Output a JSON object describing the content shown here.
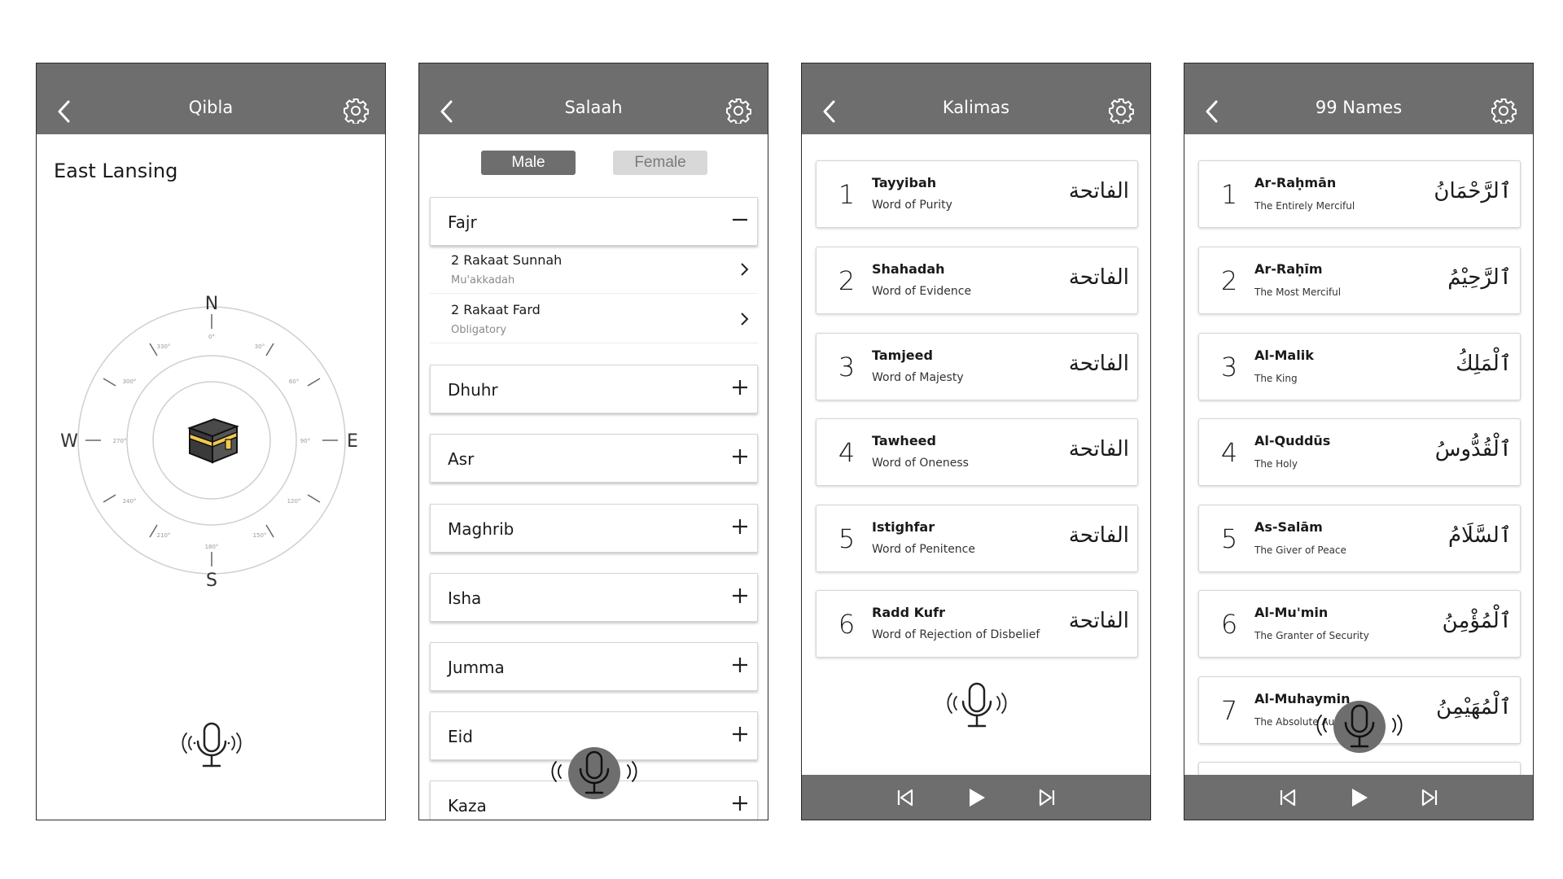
{
  "qibla": {
    "title": "Qibla",
    "city": "East Lansing",
    "compass": {
      "n": "N",
      "e": "E",
      "s": "S",
      "w": "W",
      "deg0": "0°",
      "deg30": "30°",
      "deg60": "60°",
      "deg90": "90°",
      "deg120": "120°",
      "deg150": "150°",
      "deg180": "180°",
      "deg210": "210°",
      "deg240": "240°",
      "deg270": "270°",
      "deg300": "300°",
      "deg330": "330°"
    }
  },
  "salaah": {
    "title": "Salaah",
    "male": "Male",
    "female": "Female",
    "fajr": "Fajr",
    "fajr_items": [
      {
        "title": "2 Rakaat Sunnah",
        "sub": "Mu'akkadah"
      },
      {
        "title": "2 Rakaat Fard",
        "sub": "Obligatory"
      }
    ],
    "prayers": [
      "Dhuhr",
      "Asr",
      "Maghrib",
      "Isha",
      "Jumma",
      "Eid",
      "Kaza"
    ]
  },
  "kalimas": {
    "title": "Kalimas",
    "items": [
      {
        "num": "1",
        "title": "Tayyibah",
        "sub": "Word of Purity",
        "arabic": "الفاتحة"
      },
      {
        "num": "2",
        "title": "Shahadah",
        "sub": "Word of Evidence",
        "arabic": "الفاتحة"
      },
      {
        "num": "3",
        "title": "Tamjeed",
        "sub": "Word of Majesty",
        "arabic": "الفاتحة"
      },
      {
        "num": "4",
        "title": "Tawheed",
        "sub": "Word of Oneness",
        "arabic": "الفاتحة"
      },
      {
        "num": "5",
        "title": "Istighfar",
        "sub": "Word of Penitence",
        "arabic": "الفاتحة"
      },
      {
        "num": "6",
        "title": "Radd Kufr",
        "sub": "Word of Rejection of Disbelief",
        "arabic": "الفاتحة"
      }
    ]
  },
  "names": {
    "title": "99 Names",
    "items": [
      {
        "num": "1",
        "title": "Ar-Raḥmān",
        "sub": "The Entirely Merciful",
        "arabic": "ٱلرَّحْمَانُ"
      },
      {
        "num": "2",
        "title": "Ar-Raḥīm",
        "sub": "The Most Merciful",
        "arabic": "ٱلرَّحِيْمُ"
      },
      {
        "num": "3",
        "title": "Al-Malik",
        "sub": "The King",
        "arabic": "ٱلْمَلِكُ"
      },
      {
        "num": "4",
        "title": "Al-Quddūs",
        "sub": "The Holy",
        "arabic": "ٱلْقُدُّوسُ"
      },
      {
        "num": "5",
        "title": "As-Salām",
        "sub": "The Giver of Peace",
        "arabic": "ٱلسَّلَامُ"
      },
      {
        "num": "6",
        "title": "Al-Mu'min",
        "sub": "The Granter of Security",
        "arabic": "ٱلْمُؤْمِنُ"
      },
      {
        "num": "7",
        "title": "Al-Muhaymin",
        "sub": "The Absolute Authority",
        "arabic": "ٱلْمُهَيْمِنُ"
      }
    ]
  },
  "colors": {
    "header": "#6e6e6e",
    "male_active": "#6e6e6e",
    "female_inactive": "#d8d8d8"
  }
}
